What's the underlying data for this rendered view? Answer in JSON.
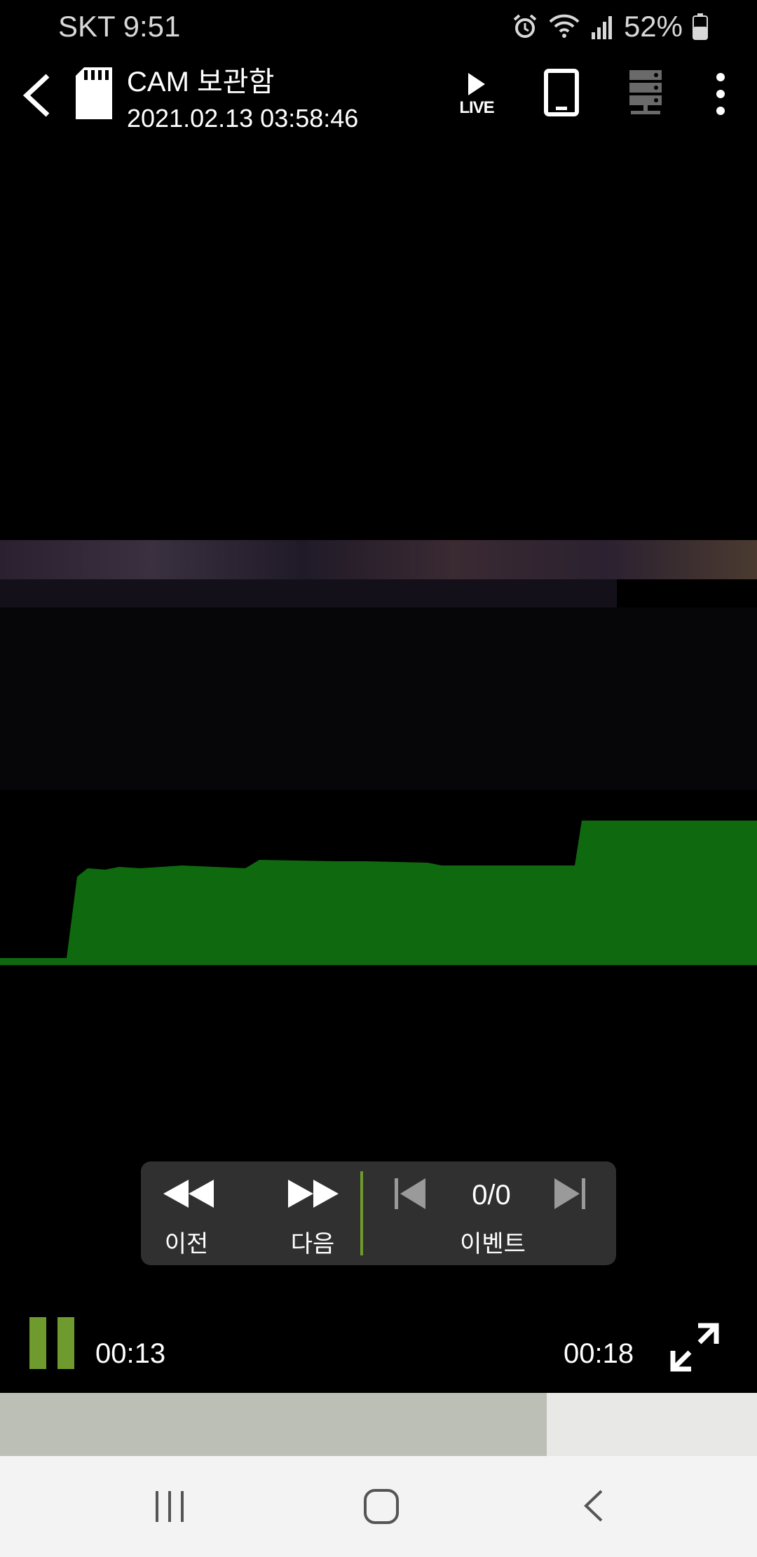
{
  "status_bar": {
    "carrier": "SKT",
    "time": "9:51",
    "battery": "52%",
    "icons": [
      "alarm-icon",
      "wifi-icon",
      "signal-icon",
      "battery-icon"
    ]
  },
  "header": {
    "title": "CAM 보관함",
    "subtitle": "2021.02.13 03:58:46",
    "live_label": "LIVE",
    "icons": [
      "back-icon",
      "sd-card-icon",
      "play-live-icon",
      "phone-icon",
      "server-icon",
      "more-icon"
    ]
  },
  "controls": {
    "prev_label": "이전",
    "next_label": "다음",
    "event_count": "0/0",
    "event_label": "이벤트",
    "elapsed": "00:13",
    "total": "00:18",
    "progress": 0.722
  },
  "colors": {
    "accent": "#6f9a2e",
    "panel_bg": "#303030",
    "progress_fill": "#bcbfb5",
    "progress_track": "#e8e8e6",
    "video_green": "#0f6a0f"
  }
}
